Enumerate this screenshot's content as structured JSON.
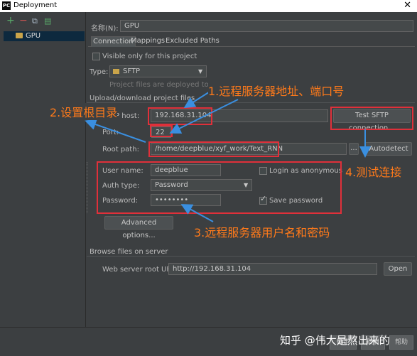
{
  "window": {
    "app_icon": "PC",
    "title": "Deployment",
    "close_glyph": "✕"
  },
  "left": {
    "toolbar": [
      {
        "icon": "add-icon",
        "glyph": "+"
      },
      {
        "icon": "remove-icon",
        "glyph": "−"
      },
      {
        "icon": "copy-icon",
        "glyph": "⧉"
      },
      {
        "icon": "default-server-icon",
        "glyph": "▤"
      }
    ],
    "tree_items": [
      {
        "label": "GPU"
      }
    ]
  },
  "header": {
    "name_label": "名称(N):",
    "name_value": "GPU"
  },
  "tabs": [
    "Connection",
    "Mappings",
    "Excluded Paths"
  ],
  "connection": {
    "visible_only_label": "Visible only for this project",
    "type_label": "Type:",
    "type_value": "SFTP",
    "type_hint": "Project files are deployed to a remo",
    "upload_section": "Upload/download project files",
    "sftp_host_label": "SFTP host:",
    "sftp_host_value": "192.168.31.104",
    "test_button": "Test SFTP connection...",
    "port_label": "Port:",
    "port_value": "22",
    "root_path_label": "Root path:",
    "root_path_value": "/home/deepblue/xyf_work/Text_RNN",
    "browse_glyph": "...",
    "autodetect_button": "Autodetect",
    "username_label": "User name:",
    "username_value": "deepblue",
    "anonymous_label": "Login as anonymous",
    "auth_type_label": "Auth type:",
    "auth_type_value": "Password",
    "password_label": "Password:",
    "password_value": "••••••••",
    "save_password_label": "Save password",
    "advanced_button": "Advanced options...",
    "browse_section": "Browse files on server",
    "web_root_label": "Web server root URL:",
    "web_root_value": "http://192.168.31.104",
    "open_button": "Open"
  },
  "annotations": {
    "a1": "1.远程服务器地址、端口号",
    "a2": "2.设置根目录",
    "a3": "3.远程服务器用户名和密码",
    "a4": "4.测试连接"
  },
  "footer": {
    "ok_button": "确定",
    "cancel_button": "取消",
    "help_button": "帮助",
    "watermark": "知乎 @伟大是熬出来的"
  },
  "colors": {
    "annotation": "#ff7a1a",
    "highlight_box": "#e0303a",
    "arrow": "#3a8fe0"
  }
}
